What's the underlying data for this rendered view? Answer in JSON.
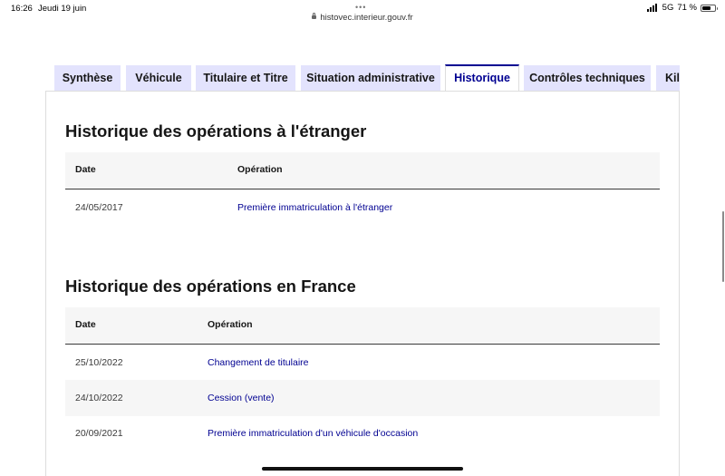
{
  "status_bar": {
    "time": "16:26",
    "date": "Jeudi 19 juin",
    "dots": "•••",
    "url": "histovec.interieur.gouv.fr",
    "network": "5G",
    "battery": "71 %",
    "battery_level": 0.71
  },
  "tabs": [
    {
      "label": "Synthèse"
    },
    {
      "label": "Véhicule"
    },
    {
      "label": "Titulaire et Titre"
    },
    {
      "label": "Situation administrative"
    },
    {
      "label": "Historique"
    },
    {
      "label": "Contrôles techniques"
    },
    {
      "label": "Kilométrage"
    }
  ],
  "active_tab": "Historique",
  "abroad": {
    "title": "Historique des opérations à l'étranger",
    "col_date": "Date",
    "col_operation": "Opération",
    "rows": [
      {
        "date": "24/05/2017",
        "operation": "Première immatriculation à l'étranger"
      }
    ]
  },
  "france": {
    "title": "Historique des opérations en France",
    "col_date": "Date",
    "col_operation": "Opération",
    "rows": [
      {
        "date": "25/10/2022",
        "operation": "Changement de titulaire"
      },
      {
        "date": "24/10/2022",
        "operation": "Cession (vente)"
      },
      {
        "date": "20/09/2021",
        "operation": "Première immatriculation d'un véhicule d'occasion"
      }
    ]
  },
  "colors": {
    "link": "#000091",
    "tab_background": "#e3e3fd",
    "table_header_background": "#f6f6f6"
  }
}
